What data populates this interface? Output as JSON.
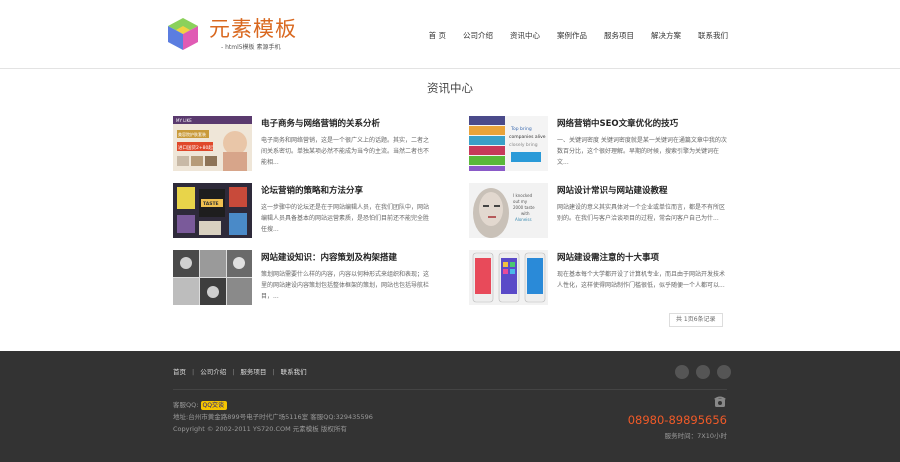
{
  "header": {
    "logo_title": "元素模板",
    "logo_subtitle": "- html5模板  素源手机",
    "nav": [
      "首 页",
      "公司介绍",
      "资讯中心",
      "案例作品",
      "服务项目",
      "解决方案",
      "联系我们"
    ]
  },
  "main": {
    "section_title": "资讯中心",
    "articles": [
      {
        "title": "电子商务与网络营销的关系分析",
        "summary": "电子商务和网络营销，这是一个很广义上的话题。其实，二者之间关系密切。单独某项必然不能成为当今的主流。当然二者也不能相...",
        "thumb": [
          "MY LIKE",
          "美容院护肤套装",
          "进口国货2+80起"
        ]
      },
      {
        "title": "网络营销中SEO文章优化的技巧",
        "summary": "一、关键词密度 关键词密度就是某一关键词在通篇文章中我的次数百分比，这个很好理解。早期的时候，搜索引擎为关键词在文...",
        "thumb": [
          "Top bring",
          "companies alive",
          "closely bring"
        ]
      },
      {
        "title": "论坛营销的策略和方法分享",
        "summary": "这一步骤中的论坛还是在于网站编辑人员，在我们团队中，网站编辑人员具备基本的网站运营素质，是恐怕们目前还不能完全胜任搜...",
        "thumb": [
          "TASTE"
        ]
      },
      {
        "title": "网站设计常识与网站建设教程",
        "summary": "网站建设的意义其实具体对一个企业或单位而言，都是不有所区别的。在我们与客户洽谈项目的过程，常会问客户自己为什...",
        "thumb": [
          "I knocked",
          "out my",
          "2000 taste",
          "with",
          "Aloneiss"
        ]
      },
      {
        "title": "网站建设知识：内容策划及构架搭建",
        "summary": "策划网站需要什么样的内容，内容以何种形式来组织和表现；这里的网站建设内容策划包括整体框架的策划，网站也包括导航栏目，...",
        "thumb": []
      },
      {
        "title": "网站建设需注意的十大事项",
        "summary": "现在基本每个大学都开设了计算机专业，而且由于网站开发技术人性化，这样使得网站制作门槛很低，似乎随便一个人都可以...",
        "thumb": []
      }
    ],
    "pager": "共 1页6条记录"
  },
  "footer": {
    "nav": [
      "首页",
      "公司介绍",
      "服务项目",
      "联系我们"
    ],
    "qq_label": "客服QQ:",
    "qq_button": "QQ交谈",
    "address": "地址:台州市黄金路899号电子时代广场5116室 客服QQ:329435596",
    "copyright": "Copyright © 2002-2011 YS720.COM 元素模板 版权所有",
    "phone": "08980-89895656",
    "hours": "服务时间：7X10小时"
  },
  "colors": {
    "accent": "#d9681f",
    "phone": "#f05a28",
    "footer_bg": "#333333"
  }
}
